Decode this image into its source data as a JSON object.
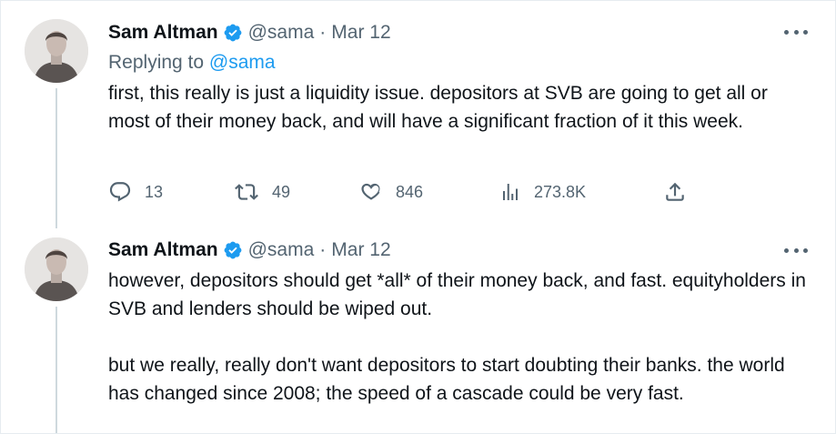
{
  "tweets": [
    {
      "author_name": "Sam Altman",
      "handle": "@sama",
      "separator": "·",
      "date": "Mar 12",
      "replying_prefix": "Replying to",
      "replying_handle": "@sama",
      "text_paragraphs": [
        "first, this really is just a liquidity issue. depositors at SVB are going to get all or most of their money back, and will have a significant fraction of it this week."
      ],
      "actions": {
        "replies": "13",
        "retweets": "49",
        "likes": "846",
        "views": "273.8K"
      }
    },
    {
      "author_name": "Sam Altman",
      "handle": "@sama",
      "separator": "·",
      "date": "Mar 12",
      "text_paragraphs": [
        "however, depositors should get *all* of their money back, and fast. equityholders in SVB and lenders should be wiped out.",
        "but we really, really don't want depositors to start doubting their banks. the world has changed since 2008; the speed of a cascade could be very fast."
      ]
    }
  ],
  "icons": {
    "verified": "verified-badge-icon",
    "more": "more-options-icon",
    "reply": "reply-icon",
    "retweet": "retweet-icon",
    "like": "like-icon",
    "views": "views-icon",
    "share": "share-icon"
  },
  "colors": {
    "accent": "#1d9bf0",
    "text_primary": "#0f1419",
    "text_secondary": "#536471",
    "thread_line": "#cfd9de"
  }
}
